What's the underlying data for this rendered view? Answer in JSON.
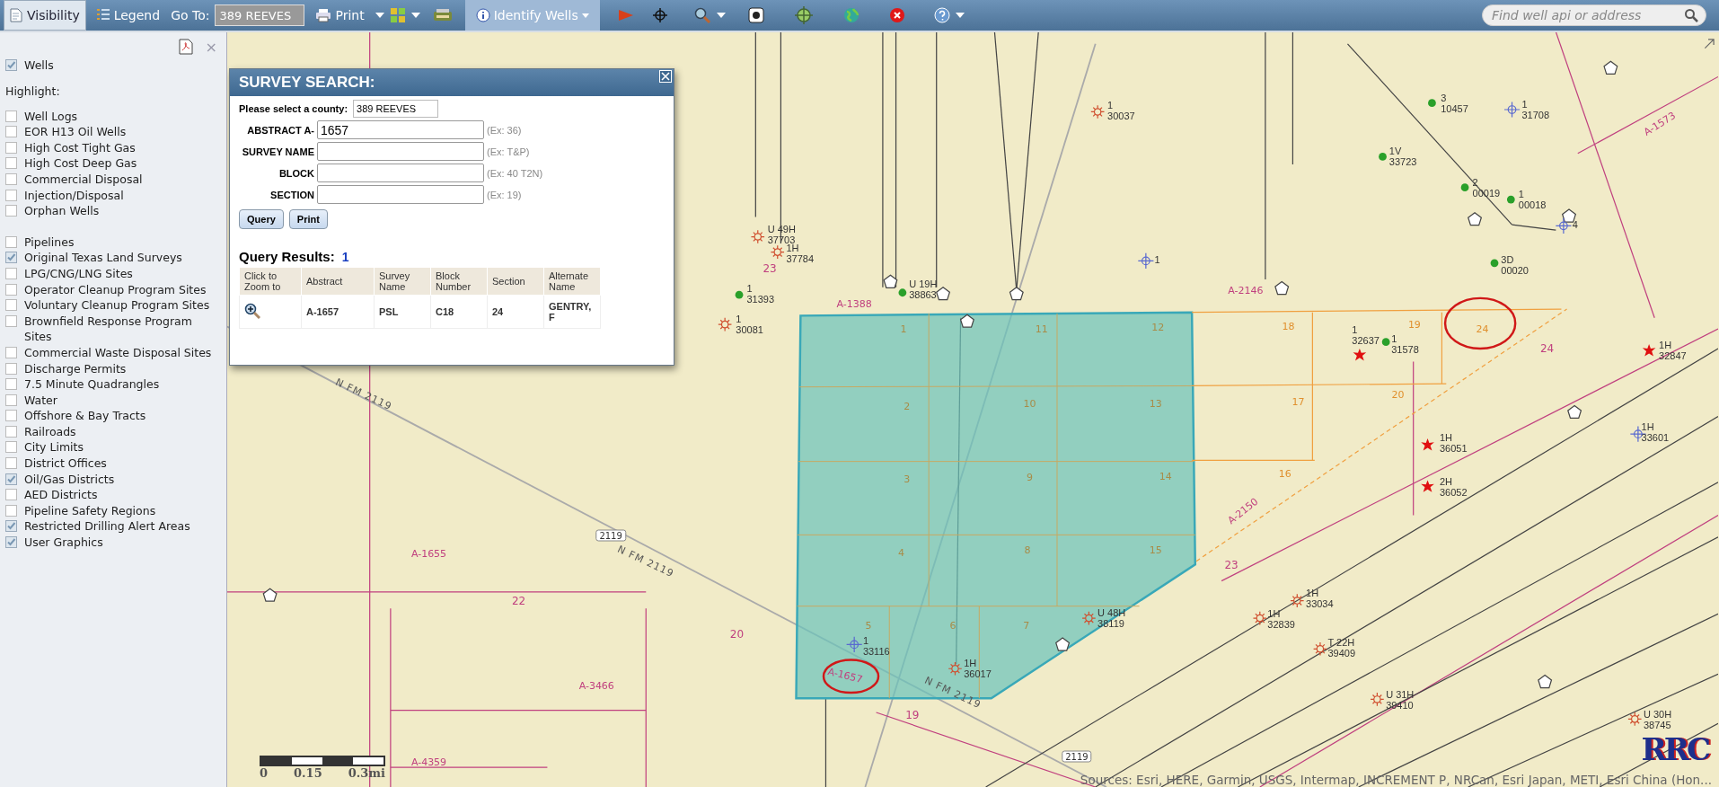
{
  "toolbar": {
    "tabs": [
      {
        "label": "Visibility",
        "selected": true
      },
      {
        "label": "Legend",
        "selected": false
      }
    ],
    "goto": {
      "label": "Go To:",
      "value": "389 REEVES"
    },
    "print": {
      "label": "Print"
    },
    "identify": {
      "label": "Identify Wells",
      "selected": true
    },
    "search": {
      "placeholder": "Find well api or address"
    }
  },
  "sidebar": {
    "close": "×",
    "wells": {
      "label": "Wells",
      "checked": true
    },
    "highlight_label": "Highlight:",
    "highlight": [
      {
        "label": "Well Logs",
        "checked": false
      },
      {
        "label": "EOR H13 Oil Wells",
        "checked": false
      },
      {
        "label": "High Cost Tight Gas",
        "checked": false
      },
      {
        "label": "High Cost Deep Gas",
        "checked": false
      },
      {
        "label": "Commercial Disposal",
        "checked": false
      },
      {
        "label": "Injection/Disposal",
        "checked": false
      },
      {
        "label": "Orphan Wells",
        "checked": false
      }
    ],
    "layers": [
      {
        "label": "Pipelines",
        "checked": false
      },
      {
        "label": "Original Texas Land Surveys",
        "checked": true
      },
      {
        "label": "LPG/CNG/LNG Sites",
        "checked": false
      },
      {
        "label": "Operator Cleanup Program Sites",
        "checked": false
      },
      {
        "label": "Voluntary Cleanup Program Sites",
        "checked": false
      },
      {
        "label": "Brownfield Response Program Sites",
        "checked": false
      },
      {
        "label": "Commercial Waste Disposal Sites",
        "checked": false
      },
      {
        "label": "Discharge Permits",
        "checked": false
      },
      {
        "label": "7.5 Minute Quadrangles",
        "checked": false
      },
      {
        "label": "Water",
        "checked": false
      },
      {
        "label": "Offshore & Bay Tracts",
        "checked": false
      },
      {
        "label": "Railroads",
        "checked": false
      },
      {
        "label": "City Limits",
        "checked": false
      },
      {
        "label": "District Offices",
        "checked": false
      },
      {
        "label": "Oil/Gas Districts",
        "checked": true
      },
      {
        "label": "AED Districts",
        "checked": false
      },
      {
        "label": "Pipeline Safety Regions",
        "checked": false
      },
      {
        "label": "Restricted Drilling Alert Areas",
        "checked": true
      },
      {
        "label": "User Graphics",
        "checked": true
      }
    ]
  },
  "dialog": {
    "title": "SURVEY SEARCH:",
    "county_label": "Please select a county:",
    "county": "389 REEVES",
    "fields": [
      {
        "label": "ABSTRACT A-",
        "value": "1657",
        "hint": "(Ex: 36)"
      },
      {
        "label": "SURVEY NAME",
        "hint": "(Ex: T&P)"
      },
      {
        "label": "BLOCK",
        "hint": "(Ex: 40 T2N)"
      },
      {
        "label": "SECTION",
        "hint": "(Ex: 19)"
      }
    ],
    "buttons": [
      "Query",
      "Print"
    ],
    "results_label": "Query Results:",
    "results_count": "1",
    "columns": [
      "Click to Zoom to",
      "Abstract",
      "Survey Name",
      "Block Number",
      "Section",
      "Alternate Name"
    ],
    "rows": [
      [
        "",
        "A-1657",
        "PSL",
        "C18",
        "24",
        "GENTRY, F"
      ]
    ]
  },
  "map": {
    "wells": [
      {
        "kind": "permit",
        "number": "1",
        "api": "30037"
      },
      {
        "kind": "oil",
        "number": "3",
        "api": "10457"
      },
      {
        "kind": "plugged",
        "number": "1",
        "api": "31708"
      },
      {
        "kind": "oil",
        "number": "1V",
        "api": "33723"
      },
      {
        "kind": "oil",
        "number": "2",
        "api": "00019"
      },
      {
        "kind": "oil",
        "number": "1",
        "api": "00018"
      },
      {
        "kind": "plugged",
        "number": "4"
      },
      {
        "kind": "oil",
        "number": "3D",
        "api": "00020"
      },
      {
        "kind": "permit",
        "number": "U 49H",
        "api": "37703"
      },
      {
        "kind": "permit",
        "number": "1H",
        "api": "37784"
      },
      {
        "kind": "plugged",
        "number": "1"
      },
      {
        "kind": "oil",
        "number": "1",
        "api": "31393"
      },
      {
        "kind": "oil",
        "number": "U 19H",
        "api": "38863"
      },
      {
        "kind": "permit",
        "number": "1",
        "api": "30081"
      },
      {
        "kind": "gas",
        "number": "1",
        "api": "32637"
      },
      {
        "kind": "oil",
        "number": "1",
        "api": "31578"
      },
      {
        "kind": "gas",
        "number": "1H",
        "api": "32847"
      },
      {
        "kind": "plugged",
        "number": "1H",
        "api": "33601"
      },
      {
        "kind": "gas",
        "number": "1H",
        "api": "36051"
      },
      {
        "kind": "gas",
        "number": "2H",
        "api": "36052"
      },
      {
        "kind": "permit",
        "number": "U 48H",
        "api": "38119"
      },
      {
        "kind": "permit",
        "number": "1H",
        "api": "33034"
      },
      {
        "kind": "permit",
        "number": "1H",
        "api": "32839"
      },
      {
        "kind": "permit",
        "number": "T 22H",
        "api": "39409"
      },
      {
        "kind": "permit",
        "number": "U 31H",
        "api": "39410"
      },
      {
        "kind": "permit",
        "number": "U 30H",
        "api": "38745"
      },
      {
        "kind": "plugged",
        "number": "1",
        "api": "33116"
      },
      {
        "kind": "permit",
        "number": "1H",
        "api": "36017"
      }
    ],
    "labels": [
      {
        "kind": "survey",
        "text": "A-1388"
      },
      {
        "kind": "survey",
        "text": "A-2146"
      },
      {
        "kind": "survey",
        "text": "A-1573"
      },
      {
        "kind": "survey",
        "text": "A-2150"
      },
      {
        "kind": "survey",
        "text": "A-1655"
      },
      {
        "kind": "survey",
        "text": "A-3466"
      },
      {
        "kind": "survey",
        "text": "A-4359"
      },
      {
        "kind": "survey",
        "text": "A-1657"
      },
      {
        "kind": "section",
        "text": "1"
      },
      {
        "kind": "section",
        "text": "11"
      },
      {
        "kind": "section",
        "text": "12"
      },
      {
        "kind": "section",
        "text": "2"
      },
      {
        "kind": "section",
        "text": "10"
      },
      {
        "kind": "section",
        "text": "13"
      },
      {
        "kind": "section",
        "text": "3"
      },
      {
        "kind": "section",
        "text": "9"
      },
      {
        "kind": "section",
        "text": "14"
      },
      {
        "kind": "section",
        "text": "4"
      },
      {
        "kind": "section",
        "text": "8"
      },
      {
        "kind": "section",
        "text": "15"
      },
      {
        "kind": "section",
        "text": "5"
      },
      {
        "kind": "section",
        "text": "6"
      },
      {
        "kind": "section",
        "text": "7"
      },
      {
        "kind": "tract",
        "text": "18"
      },
      {
        "kind": "tract",
        "text": "19"
      },
      {
        "kind": "tract",
        "text": "24"
      },
      {
        "kind": "tract",
        "text": "17"
      },
      {
        "kind": "tract",
        "text": "20"
      },
      {
        "kind": "tract",
        "text": "16"
      },
      {
        "kind": "grid",
        "text": "24"
      },
      {
        "kind": "grid",
        "text": "23"
      },
      {
        "kind": "grid",
        "text": "22"
      },
      {
        "kind": "grid",
        "text": "20"
      },
      {
        "kind": "grid",
        "text": "19"
      },
      {
        "kind": "grid",
        "text": "23"
      },
      {
        "kind": "road",
        "text": "N FM 2119"
      },
      {
        "kind": "road",
        "text": "N FM 2119"
      },
      {
        "kind": "road",
        "text": "N FM 2119"
      },
      {
        "kind": "shield",
        "text": "2119"
      },
      {
        "kind": "shield",
        "text": "2119"
      }
    ],
    "scale": [
      "0",
      "0.15",
      "0.3mi"
    ],
    "attribution": "Sources: Esri, HERE, Garmin, USGS, Intermap, INCREMENT P, NRCan, Esri Japan, METI, Esri China (Hon...",
    "logo": "RRC"
  }
}
